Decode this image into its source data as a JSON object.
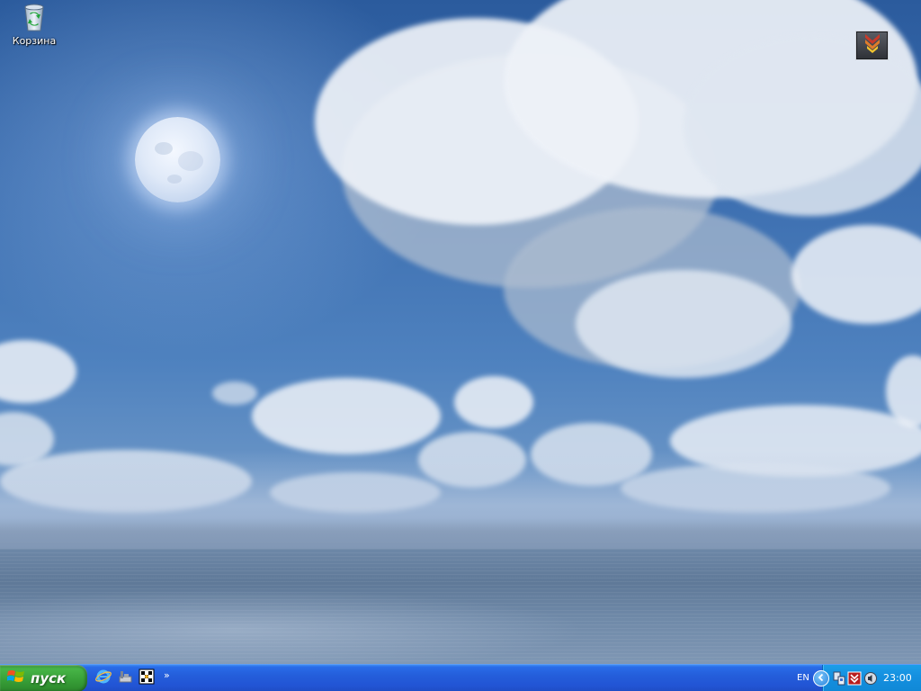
{
  "desktop": {
    "icons": [
      {
        "label": "Корзина",
        "icon": "recycle-bin-icon"
      }
    ],
    "widget": {
      "icon": "download-arrows-icon"
    }
  },
  "taskbar": {
    "start_label": "пуск",
    "quick_launch": [
      {
        "icon": "internet-explorer-icon"
      },
      {
        "icon": "show-desktop-icon"
      },
      {
        "icon": "app-icon"
      }
    ],
    "more_label": "»",
    "tray": {
      "language": "EN",
      "icons": [
        "expand-tray-icon",
        "network-icon",
        "antivirus-icon",
        "volume-icon"
      ],
      "clock": "23:00"
    }
  },
  "colors": {
    "taskbar": "#245edb",
    "start_button": "#3aa33a",
    "tray": "#1590e0"
  }
}
